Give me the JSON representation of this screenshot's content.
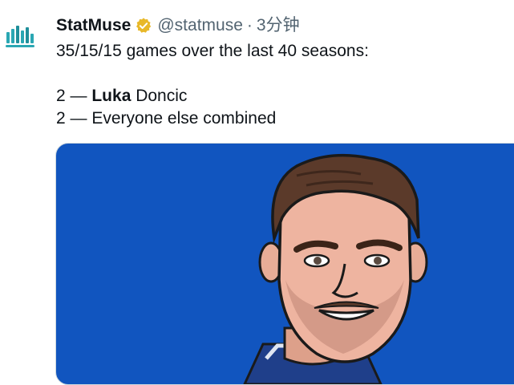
{
  "author": {
    "name": "StatMuse",
    "handle": "@statmuse",
    "separator": "·",
    "time": "3分钟",
    "verified_icon": "verified-badge-icon",
    "avatar_icon": "statmuse-logo-icon"
  },
  "tweet": {
    "line1": "35/15/15 games over the last 40 seasons:",
    "line2_count": "2 — ",
    "line2_bold": "Luka",
    "line2_rest": " Doncic",
    "line3": "2 — Everyone else combined"
  },
  "media": {
    "background_color": "#1155bf",
    "illustration": "player-cartoon-illustration"
  },
  "colors": {
    "text_primary": "#0f1419",
    "text_secondary": "#536471",
    "verified_gold": "#e8b829",
    "logo_teal": "#2aa7b3"
  }
}
